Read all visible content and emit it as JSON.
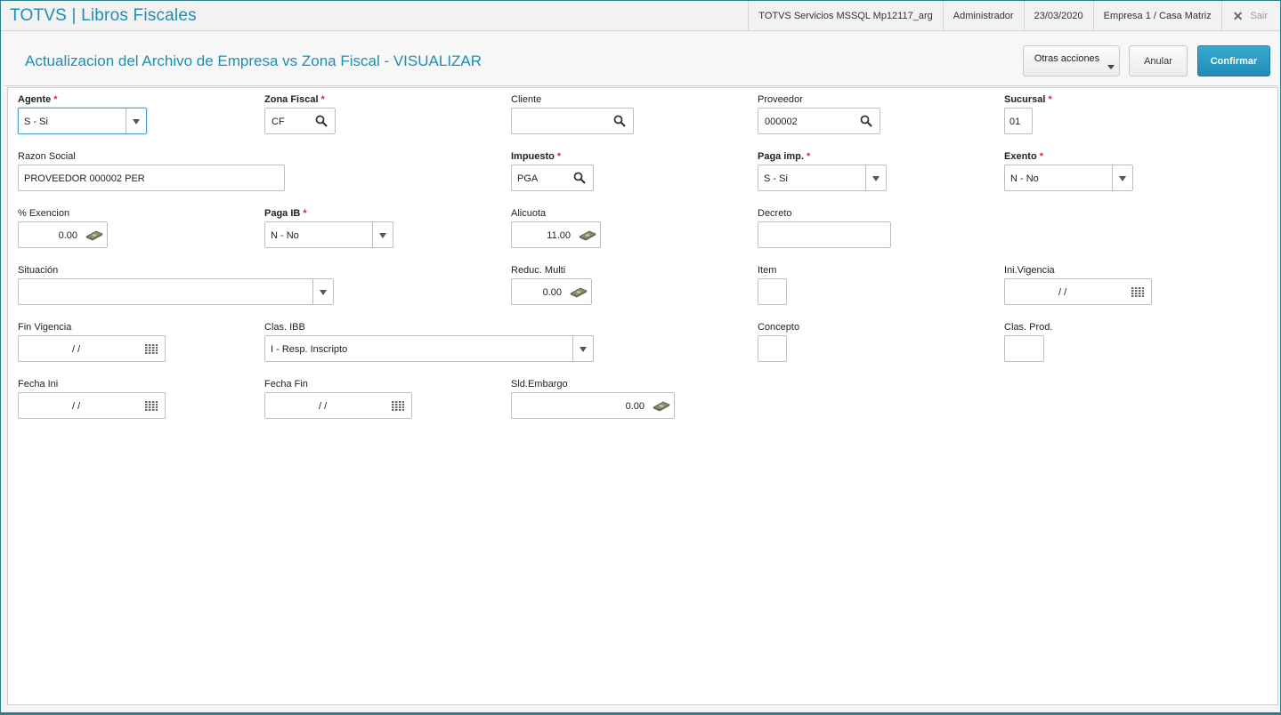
{
  "topbar": {
    "app_title": "TOTVS | Libros Fiscales",
    "environment": "TOTVS Servicios MSSQL Mp12117_arg",
    "user": "Administrador",
    "date": "23/03/2020",
    "company": "Empresa 1 / Casa Matriz",
    "exit_label": "Sair"
  },
  "header": {
    "title": "Actualizacion del Archivo de Empresa vs Zona Fiscal - VISUALIZAR",
    "otras_label": "Otras acciones",
    "anular_label": "Anular",
    "confirmar_label": "Confirmar"
  },
  "fields": {
    "agente": {
      "label": "Agente",
      "value": "S - Si"
    },
    "zona_fiscal": {
      "label": "Zona Fiscal",
      "value": "CF"
    },
    "cliente": {
      "label": "Cliente",
      "value": ""
    },
    "proveedor": {
      "label": "Proveedor",
      "value": "000002"
    },
    "sucursal": {
      "label": "Sucursal",
      "value": "01"
    },
    "razon_social": {
      "label": "Razon Social",
      "value": "PROVEEDOR 000002 PER"
    },
    "impuesto": {
      "label": "Impuesto",
      "value": "PGA"
    },
    "paga_imp": {
      "label": "Paga imp.",
      "value": "S - Si"
    },
    "exento": {
      "label": "Exento",
      "value": "N - No"
    },
    "pct_exencion": {
      "label": "% Exencion",
      "value": "0.00"
    },
    "paga_ib": {
      "label": "Paga IB",
      "value": "N - No"
    },
    "alicuota": {
      "label": "Alicuota",
      "value": "11.00"
    },
    "decreto": {
      "label": "Decreto",
      "value": ""
    },
    "situacion": {
      "label": "Situación",
      "value": ""
    },
    "reduc_multi": {
      "label": "Reduc. Multi",
      "value": "0.00"
    },
    "item": {
      "label": "Item",
      "value": ""
    },
    "ini_vigencia": {
      "label": "Ini.Vigencia",
      "value": "/ /"
    },
    "fin_vigencia": {
      "label": "Fin Vigencia",
      "value": "/ /"
    },
    "clas_ibb": {
      "label": "Clas. IBB",
      "value": "I - Resp. Inscripto"
    },
    "concepto": {
      "label": "Concepto",
      "value": ""
    },
    "clas_prod": {
      "label": "Clas. Prod.",
      "value": ""
    },
    "fecha_ini": {
      "label": "Fecha Ini",
      "value": "/ /"
    },
    "fecha_fin": {
      "label": "Fecha Fin",
      "value": "/ /"
    },
    "sld_embargo": {
      "label": "Sld.Embargo",
      "value": "0.00"
    }
  },
  "required_marker": "*",
  "colors": {
    "accent": "#1d8fb4",
    "confirm": "#2596c0",
    "required": "#e0262b"
  }
}
